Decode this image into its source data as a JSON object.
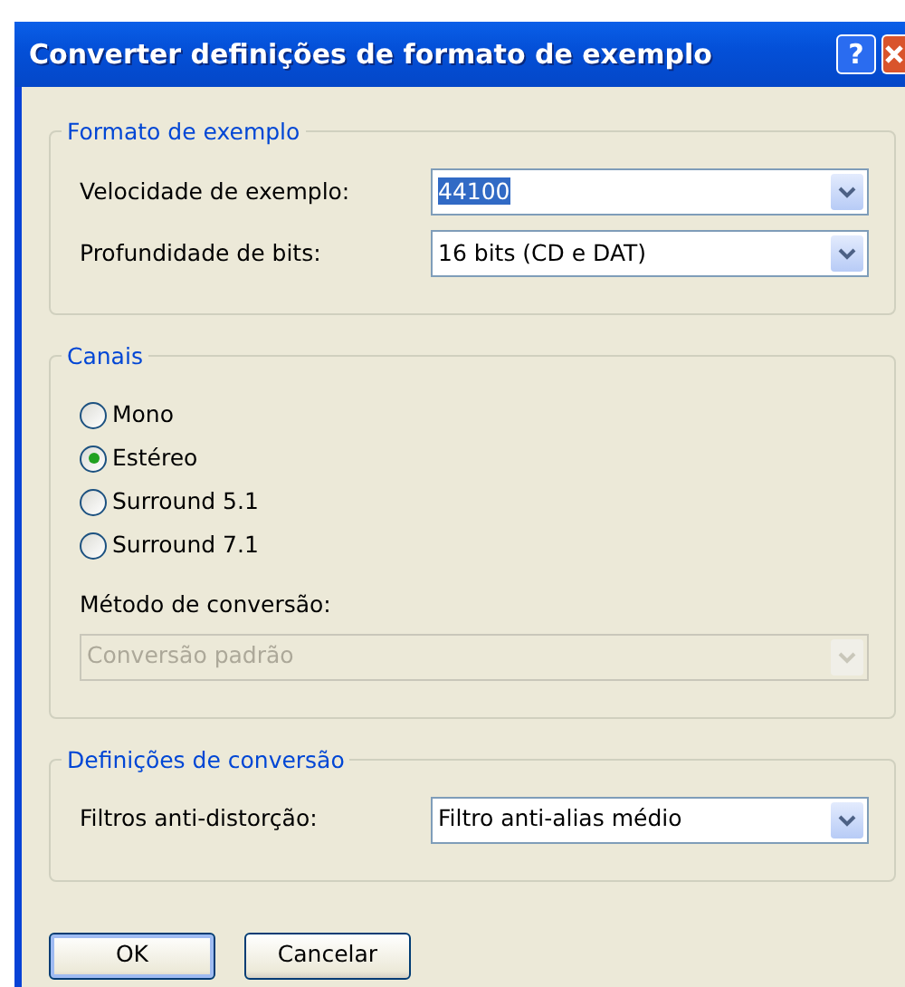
{
  "window": {
    "title": "Converter definições de formato de exemplo",
    "buttons": [
      {
        "kind": "help",
        "label": "?"
      },
      {
        "kind": "close"
      }
    ]
  },
  "groups": [
    {
      "title": "Formato de exemplo",
      "items": [
        {
          "kind": "combo",
          "label": "Velocidade de exemplo:",
          "value": "44100",
          "highlighted": true,
          "disabled": false
        },
        {
          "kind": "combo",
          "label": "Profundidade de bits:",
          "value": "16 bits (CD e DAT)",
          "highlighted": false,
          "disabled": false
        }
      ]
    },
    {
      "title": "Canais",
      "items": [
        {
          "kind": "radio",
          "label": "Mono",
          "selected": false
        },
        {
          "kind": "radio",
          "label": "Estéreo",
          "selected": true
        },
        {
          "kind": "radio",
          "label": "Surround 5.1",
          "selected": false
        },
        {
          "kind": "radio",
          "label": "Surround 7.1",
          "selected": false
        },
        {
          "kind": "stacked_combo",
          "label": "Método de conversão:",
          "value": "Conversão padrão",
          "highlighted": false,
          "disabled": true
        }
      ]
    },
    {
      "title": "Definições de conversão",
      "items": [
        {
          "kind": "combo",
          "label": "Filtros anti-distorção:",
          "value": "Filtro anti-alias médio",
          "highlighted": false,
          "disabled": false
        }
      ]
    }
  ],
  "footer_buttons": [
    {
      "label": "OK",
      "default": true
    },
    {
      "label": "Cancelar",
      "default": false
    }
  ]
}
